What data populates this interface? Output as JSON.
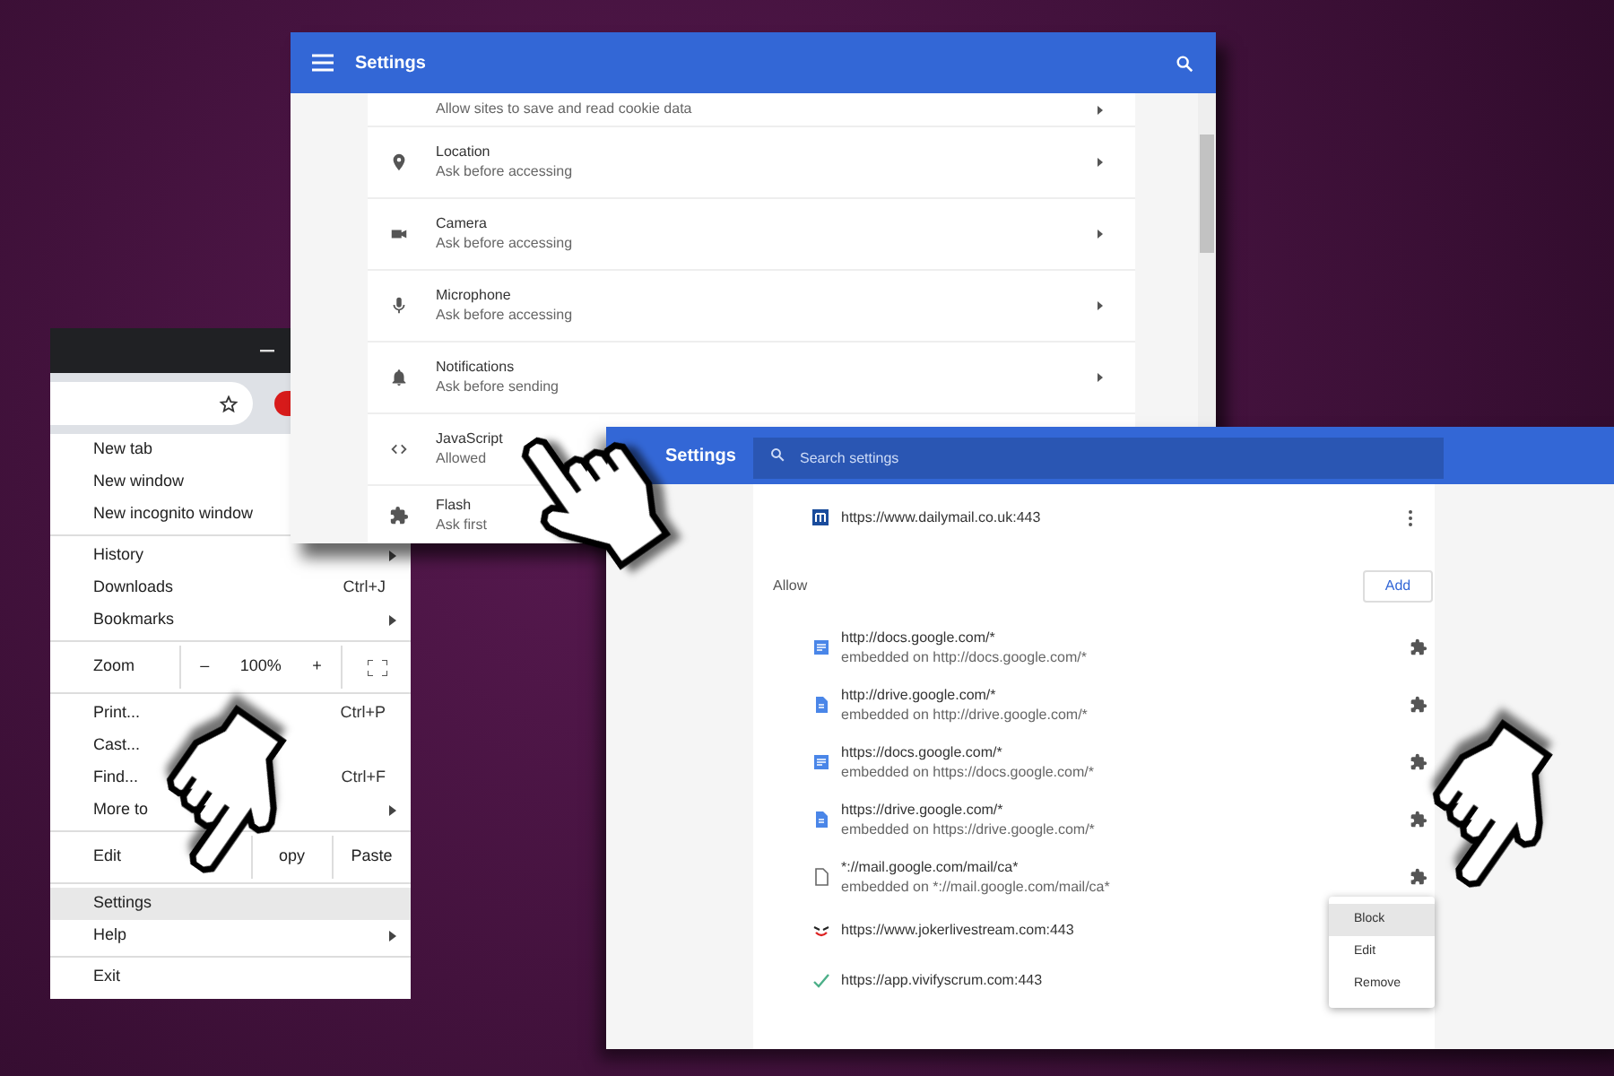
{
  "browser_menu": {
    "groups": [
      [
        {
          "kind": "item",
          "label": "New tab",
          "submenu": false,
          "selected": false
        },
        {
          "kind": "item",
          "label": "New window",
          "submenu": false,
          "selected": false
        },
        {
          "kind": "item",
          "label": "New incognito window",
          "submenu": false,
          "selected": false
        }
      ],
      [
        {
          "kind": "item",
          "label": "History",
          "submenu": true,
          "selected": false
        },
        {
          "kind": "item",
          "label": "Downloads",
          "shortcut": "Ctrl+J",
          "submenu": false,
          "selected": false
        },
        {
          "kind": "item",
          "label": "Bookmarks",
          "submenu": true,
          "selected": false
        }
      ],
      [
        {
          "kind": "zoom",
          "label": "Zoom",
          "minus": "–",
          "value": "100%",
          "plus": "+"
        }
      ],
      [
        {
          "kind": "item",
          "label": "Print...",
          "shortcut": "Ctrl+P",
          "submenu": false,
          "selected": false
        },
        {
          "kind": "item",
          "label": "Cast...",
          "submenu": false,
          "selected": false
        },
        {
          "kind": "item",
          "label": "Find...",
          "shortcut": "Ctrl+F",
          "submenu": false,
          "selected": false
        },
        {
          "kind": "item",
          "label": "More to",
          "submenu": true,
          "selected": false
        }
      ],
      [
        {
          "kind": "edit",
          "label": "Edit",
          "actions": [
            "opy",
            "Paste"
          ]
        }
      ],
      [
        {
          "kind": "item",
          "label": "Settings",
          "submenu": false,
          "selected": true
        },
        {
          "kind": "item",
          "label": "Help",
          "submenu": true,
          "selected": false
        }
      ],
      [
        {
          "kind": "item",
          "label": "Exit",
          "submenu": false,
          "selected": false
        }
      ]
    ]
  },
  "site_settings": {
    "title": "Settings",
    "rows": [
      {
        "subtitle": "Allow sites to save and read cookie data"
      },
      {
        "title": "Location",
        "subtitle": "Ask before accessing"
      },
      {
        "title": "Camera",
        "subtitle": "Ask before accessing"
      },
      {
        "title": "Microphone",
        "subtitle": "Ask before accessing"
      },
      {
        "title": "Notifications",
        "subtitle": "Ask before sending"
      },
      {
        "title": "JavaScript",
        "subtitle": "Allowed"
      },
      {
        "title": "Flash",
        "subtitle": "Ask first"
      }
    ]
  },
  "flash_settings": {
    "title": "Settings",
    "search": {
      "placeholder": "Search settings"
    },
    "top_site": "https://www.dailymail.co.uk:443",
    "section": "Allow",
    "add_button": "Add",
    "sites": [
      {
        "url": "http://docs.google.com/*",
        "embedded": "embedded on http://docs.google.com/*"
      },
      {
        "url": "http://drive.google.com/*",
        "embedded": "embedded on http://drive.google.com/*"
      },
      {
        "url": "https://docs.google.com/*",
        "embedded": "embedded on https://docs.google.com/*"
      },
      {
        "url": "https://drive.google.com/*",
        "embedded": "embedded on https://drive.google.com/*"
      },
      {
        "url": "*://mail.google.com/mail/ca*",
        "embedded": "embedded on *://mail.google.com/mail/ca*"
      },
      {
        "url": "https://www.jokerlivestream.com:443"
      },
      {
        "url": "https://app.vivifyscrum.com:443"
      }
    ],
    "context_menu": [
      {
        "label": "Block",
        "selected": true
      },
      {
        "label": "Edit",
        "selected": false
      },
      {
        "label": "Remove",
        "selected": false
      }
    ]
  }
}
